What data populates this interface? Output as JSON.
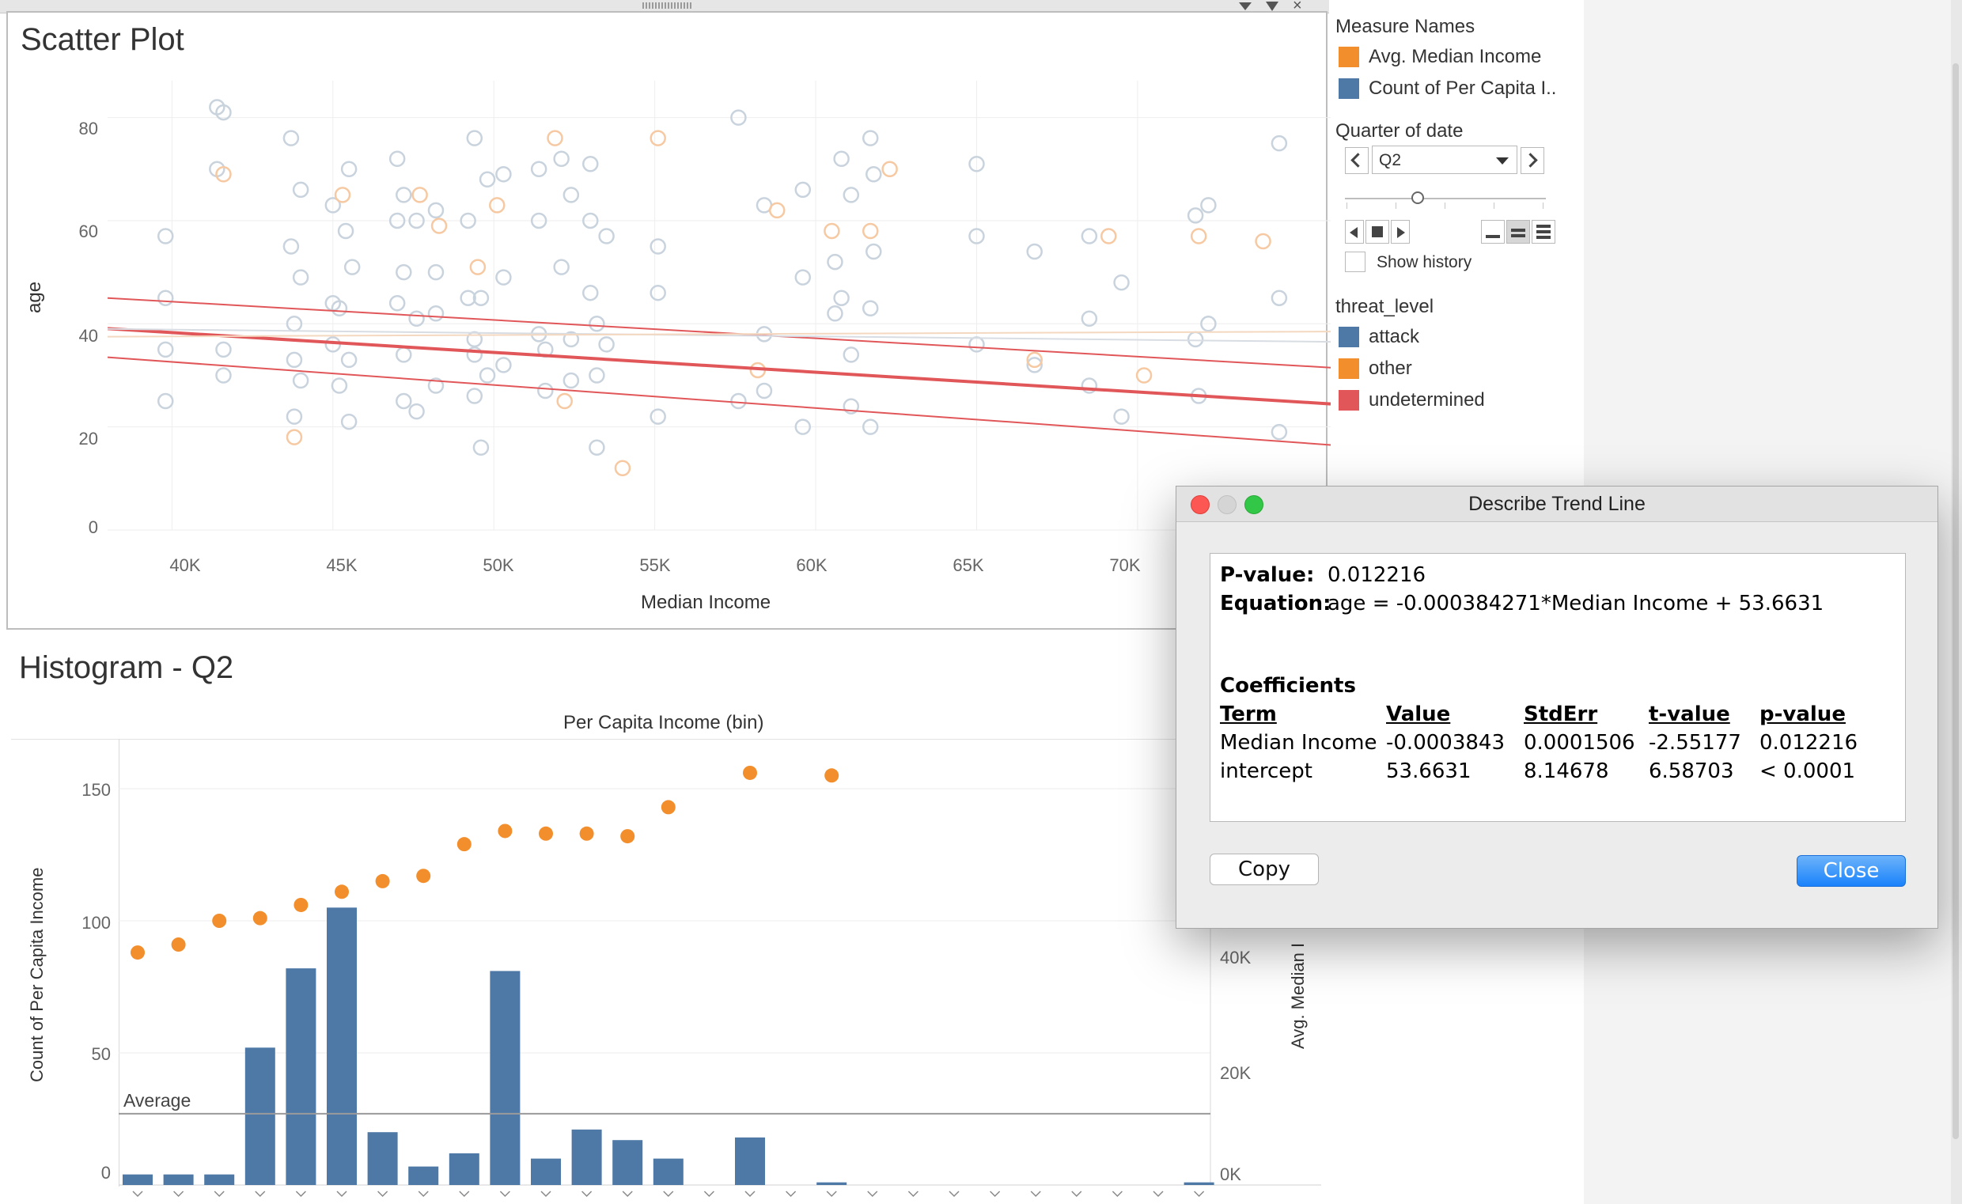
{
  "scatter": {
    "title": "Scatter Plot",
    "xlabel": "Median Income",
    "ylabel": "age",
    "y_ticks": [
      "80",
      "60",
      "40",
      "20",
      "0"
    ],
    "x_ticks": [
      "40K",
      "45K",
      "50K",
      "55K",
      "60K",
      "65K",
      "70K"
    ]
  },
  "histogram": {
    "title": "Histogram - Q2",
    "header": "Per Capita Income (bin)",
    "ylabel_left": "Count of Per Capita Income",
    "ylabel_right": "Avg. Median I",
    "y_ticks_left": [
      "150",
      "100",
      "50",
      "0"
    ],
    "y_ticks_right": [
      "40K",
      "20K",
      "0K"
    ],
    "average_label": "Average"
  },
  "legend": {
    "measure_title": "Measure Names",
    "measures": [
      {
        "label": "Avg. Median Income",
        "color": "#f28e2b"
      },
      {
        "label": "Count of Per Capita I..",
        "color": "#4e79a7"
      }
    ],
    "quarter_title": "Quarter of date",
    "quarter_value": "Q2",
    "show_history": "Show history",
    "threat_title": "threat_level",
    "threats": [
      {
        "label": "attack",
        "color": "#4e79a7"
      },
      {
        "label": "other",
        "color": "#f28e2b"
      },
      {
        "label": "undetermined",
        "color": "#e15759"
      }
    ]
  },
  "dialog": {
    "title": "Describe Trend Line",
    "pvalue_label": "P-value:",
    "pvalue": "0.012216",
    "equation_label": "Equation:",
    "equation": "age = -0.000384271*Median Income + 53.6631",
    "coefficients_title": "Coefficients",
    "columns": [
      "Term",
      "Value",
      "StdErr",
      "t-value",
      "p-value"
    ],
    "rows": [
      [
        "Median Income",
        "-0.0003843",
        "0.0001506",
        "-2.55177",
        "0.012216"
      ],
      [
        "intercept",
        "53.6631",
        "8.14678",
        "6.58703",
        "< 0.0001"
      ]
    ],
    "copy_label": "Copy",
    "close_label": "Close"
  },
  "chart_data": [
    {
      "type": "scatter",
      "title": "Scatter Plot",
      "xlabel": "Median Income",
      "ylabel": "age",
      "xlim": [
        38000,
        76000
      ],
      "ylim": [
        0,
        85
      ],
      "x_ticks": [
        40000,
        45000,
        50000,
        55000,
        60000,
        65000,
        70000
      ],
      "y_ticks": [
        0,
        20,
        40,
        60,
        80
      ],
      "grid": true,
      "series": [
        {
          "name": "attack",
          "color": "#c9d3dd",
          "x": [
            39800,
            39800,
            39800,
            39800,
            41400,
            41600,
            41400,
            41600,
            41600,
            43700,
            43700,
            43800,
            43800,
            43800,
            44000,
            44000,
            44000,
            45000,
            45000,
            45000,
            45200,
            45200,
            45400,
            45500,
            45500,
            45500,
            45600,
            47000,
            47000,
            47000,
            47200,
            47200,
            47200,
            47200,
            47600,
            47600,
            47600,
            48200,
            48200,
            48200,
            48200,
            49200,
            49200,
            49400,
            49400,
            49400,
            49400,
            49600,
            49600,
            49800,
            49800,
            50300,
            50300,
            50300,
            51400,
            51400,
            51400,
            51600,
            51600,
            52100,
            52100,
            52400,
            52400,
            52400,
            53000,
            53000,
            53000,
            53200,
            53200,
            53200,
            53500,
            53500,
            55100,
            55100,
            55100,
            57600,
            57600,
            58400,
            58400,
            58400,
            59600,
            59600,
            59600,
            60600,
            60600,
            60800,
            60800,
            61100,
            61100,
            61100,
            61700,
            61700,
            61700,
            61800,
            61800,
            65000,
            65000,
            65000,
            66800,
            66800,
            68500,
            68500,
            68500,
            69500,
            69500,
            71800,
            71800,
            71900,
            72200,
            72200,
            74400,
            74400,
            74400
          ],
          "y": [
            57,
            35,
            25,
            45,
            82,
            81,
            70,
            30,
            35,
            76,
            55,
            33,
            22,
            40,
            66,
            49,
            29,
            63,
            44,
            36,
            43,
            28,
            58,
            70,
            33,
            21,
            51,
            72,
            60,
            44,
            65,
            50,
            34,
            25,
            60,
            41,
            23,
            62,
            50,
            42,
            28,
            60,
            45,
            37,
            26,
            76,
            34,
            16,
            45,
            68,
            30,
            69,
            49,
            32,
            70,
            60,
            38,
            35,
            27,
            72,
            51,
            37,
            65,
            29,
            71,
            60,
            46,
            40,
            30,
            16,
            36,
            57,
            55,
            46,
            22,
            80,
            25,
            63,
            38,
            27,
            66,
            49,
            20,
            52,
            42,
            72,
            45,
            65,
            34,
            24,
            76,
            43,
            20,
            69,
            54,
            71,
            57,
            36,
            54,
            32,
            57,
            41,
            28,
            48,
            22,
            61,
            37,
            26,
            63,
            40,
            75,
            45,
            19
          ]
        },
        {
          "name": "other",
          "color": "#f6c9a2",
          "x": [
            41600,
            43800,
            45300,
            47700,
            48300,
            49500,
            50100,
            51900,
            52200,
            54000,
            55100,
            58200,
            58800,
            60500,
            61700,
            62300,
            66800,
            69100,
            70200,
            71900,
            73900
          ],
          "y": [
            69,
            18,
            65,
            65,
            59,
            51,
            63,
            76,
            25,
            12,
            76,
            31,
            62,
            58,
            58,
            70,
            33,
            57,
            30,
            57,
            56
          ]
        }
      ],
      "trend_lines": [
        {
          "name": "undetermined",
          "x": [
            38000,
            76000
          ],
          "y": [
            39.06,
            24.46
          ],
          "style": "trend"
        },
        {
          "name": "undetermined upper band",
          "x": [
            38000,
            76000
          ],
          "y": [
            45.0,
            31.5
          ],
          "style": "band"
        },
        {
          "name": "undetermined lower band",
          "x": [
            38000,
            76000
          ],
          "y": [
            33.5,
            16.5
          ],
          "style": "band"
        },
        {
          "name": "attack",
          "x": [
            38000,
            76000
          ],
          "y": [
            39.0,
            36.5
          ],
          "style": "faint"
        },
        {
          "name": "other",
          "x": [
            38000,
            76000
          ],
          "y": [
            37.5,
            38.5
          ],
          "style": "faint"
        }
      ]
    },
    {
      "type": "bar",
      "title": "Histogram - Q2",
      "header": "Per Capita Income (bin)",
      "ylabel": "Count of Per Capita Income",
      "y2label": "Avg. Median I",
      "ylim": [
        0,
        160
      ],
      "y_ticks": [
        0,
        50,
        100,
        150
      ],
      "y2_ticks": [
        "0K",
        "20K",
        "40K"
      ],
      "bins": 27,
      "series": [
        {
          "name": "Count of Per Capita I..",
          "type": "bar",
          "color": "#4e79a7",
          "values": [
            4,
            4,
            4,
            52,
            82,
            105,
            20,
            7,
            12,
            81,
            10,
            21,
            17,
            10,
            0,
            18,
            0,
            1,
            0,
            0,
            0,
            0,
            0,
            0,
            0,
            0,
            1
          ]
        },
        {
          "name": "Avg. Median Income",
          "type": "dot",
          "color": "#f28e2b",
          "values": [
            88,
            91,
            100,
            101,
            106,
            111,
            115,
            117,
            129,
            134,
            133,
            133,
            132,
            143,
            null,
            156,
            null,
            155,
            null,
            null,
            null,
            null,
            null,
            null,
            null,
            null,
            null
          ]
        }
      ],
      "reference_line": {
        "label": "Average",
        "value": 27
      }
    }
  ]
}
